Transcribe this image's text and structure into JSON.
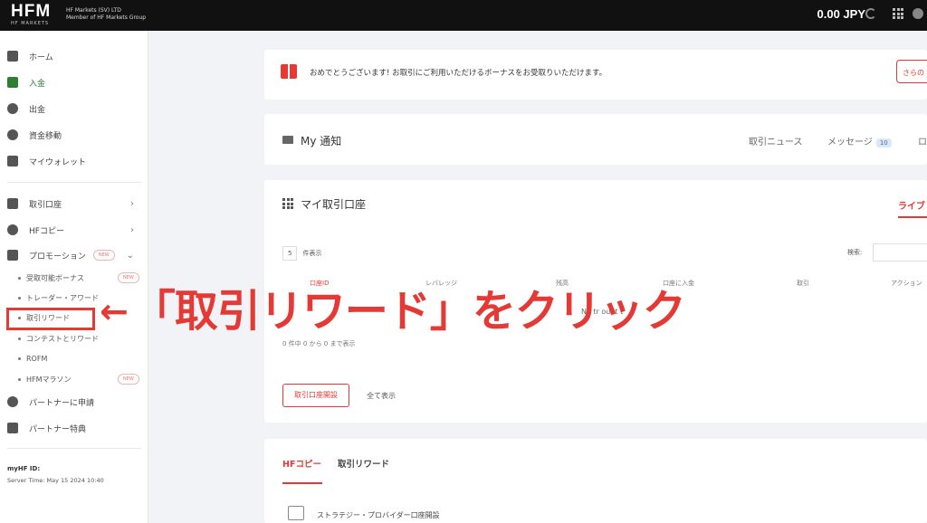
{
  "header": {
    "logo_text": "HFM",
    "logo_sub": "HF MARKETS",
    "company_line1": "HF Markets (SV) LTD",
    "company_line2": "Member of HF Markets Group",
    "balance": "0.00 JPY"
  },
  "sidebar": {
    "group1": [
      {
        "label": "ホーム",
        "icon": "home-icon"
      },
      {
        "label": "入金",
        "icon": "deposit-icon"
      },
      {
        "label": "出金",
        "icon": "withdraw-icon"
      },
      {
        "label": "資金移動",
        "icon": "transfer-icon"
      },
      {
        "label": "マイウォレット",
        "icon": "wallet-icon"
      }
    ],
    "group2": [
      {
        "label": "取引口座",
        "icon": "account-icon"
      },
      {
        "label": "HFコピー",
        "icon": "copy-icon"
      },
      {
        "label": "プロモーション",
        "icon": "promotion-icon",
        "badge": "NEW"
      }
    ],
    "promotion_subitems": [
      {
        "label": "受取可能ボーナス",
        "badge": "NEW"
      },
      {
        "label": "トレーダー・アワード"
      },
      {
        "label": "取引リワード"
      },
      {
        "label": "コンテストとリワード"
      },
      {
        "label": "ROFM"
      },
      {
        "label": "HFMマラソン",
        "badge": "NEW"
      }
    ],
    "group3": [
      {
        "label": "パートナーに申請",
        "icon": "partner-icon"
      },
      {
        "label": "パートナー特典",
        "icon": "partner-benefit-icon"
      }
    ],
    "myhf_label": "myHF ID:",
    "server_time": "Server Time: May 15 2024 10:40"
  },
  "bonus_banner": {
    "text": "おめでとうございます! お取引にご利用いただけるボーナスをお受取りいただけます。",
    "button": "さらの"
  },
  "notifications": {
    "title": "My 通知",
    "tabs": [
      "取引ニュース",
      "メッセージ",
      "ロ"
    ],
    "message_count": "10"
  },
  "accounts": {
    "title": "マイ取引口座",
    "tab_live": "ライブ",
    "show_value": "5",
    "show_label": "件表示",
    "search_label": "検索:",
    "columns": [
      "口座ID",
      "レバレッジ",
      "残高",
      "口座に入金",
      "取引",
      "アクション"
    ],
    "empty_text": "No tr          ount    t",
    "entries_text": "0 件中 0 から 0 まで表示",
    "open_button": "取引口座開設",
    "view_all": "全て表示"
  },
  "bottom": {
    "tabs": [
      "HFコピー",
      "取引リワード"
    ],
    "strategy": "ストラテジー・プロバイダー口座開設"
  },
  "annotation": {
    "arrow": "←",
    "text": "「取引リワード」をクリック",
    "color": "#e53935"
  }
}
